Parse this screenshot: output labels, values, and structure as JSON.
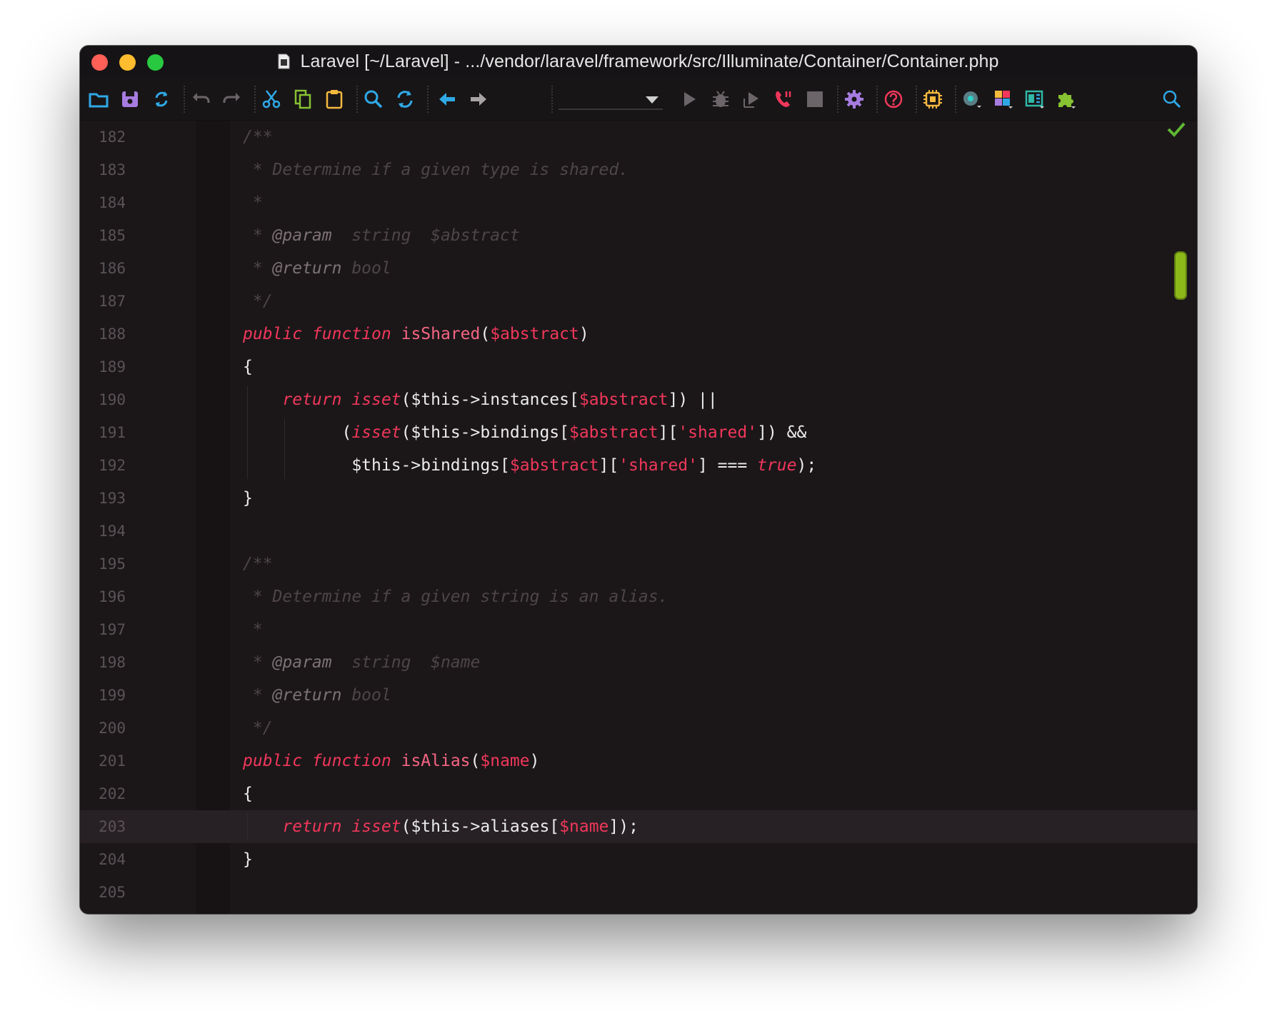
{
  "window": {
    "title": "Laravel [~/Laravel] - .../vendor/laravel/framework/src/Illuminate/Container/Container.php"
  },
  "toolbar": {
    "icons": [
      "folder-open-icon",
      "save-icon",
      "sync-icon",
      "undo-icon",
      "redo-icon",
      "cut-icon",
      "copy-icon",
      "paste-icon",
      "search-icon",
      "replace-icon",
      "back-icon",
      "forward-icon",
      "run-config-select",
      "run-icon",
      "debug-icon",
      "run-to-cursor-icon",
      "phone-listen-icon",
      "stop-icon",
      "settings-icon",
      "help-icon",
      "cpu-icon",
      "vcs-icon",
      "layout-icon",
      "panel-icon",
      "plugins-icon",
      "search-everywhere-icon"
    ],
    "run_config_value": "",
    "colors": {
      "blue": "#2fa9e6",
      "purple": "#a77ce0",
      "teal": "#2fa9e6",
      "green": "#86c232",
      "red": "#f1375a",
      "yellow": "#f5b93e"
    }
  },
  "editor": {
    "current_line": 203,
    "lines": [
      {
        "n": "182",
        "tokens": [
          [
            "cm",
            "/**"
          ]
        ]
      },
      {
        "n": "183",
        "tokens": [
          [
            "cm",
            " * Determine if a given type is shared."
          ]
        ]
      },
      {
        "n": "184",
        "tokens": [
          [
            "cm",
            " *"
          ]
        ]
      },
      {
        "n": "185",
        "tokens": [
          [
            "cm",
            " * "
          ],
          [
            "tag",
            "@param"
          ],
          [
            "cm",
            "  string  $abstract"
          ]
        ]
      },
      {
        "n": "186",
        "tokens": [
          [
            "cm",
            " * "
          ],
          [
            "tag",
            "@return"
          ],
          [
            "cm",
            " bool"
          ]
        ]
      },
      {
        "n": "187",
        "tokens": [
          [
            "cm",
            " */"
          ]
        ]
      },
      {
        "n": "188",
        "tokens": [
          [
            "kw",
            "public"
          ],
          [
            "plain",
            " "
          ],
          [
            "kw",
            "function"
          ],
          [
            "plain",
            " "
          ],
          [
            "fn",
            "isShared"
          ],
          [
            "plain",
            "("
          ],
          [
            "var",
            "$abstract"
          ],
          [
            "plain",
            ")"
          ]
        ]
      },
      {
        "n": "189",
        "tokens": [
          [
            "plain",
            "{"
          ]
        ]
      },
      {
        "n": "190",
        "tokens": [
          [
            "plain",
            "    "
          ],
          [
            "kw",
            "return"
          ],
          [
            "plain",
            " "
          ],
          [
            "kw",
            "isset"
          ],
          [
            "plain",
            "($this->instances["
          ],
          [
            "var",
            "$abstract"
          ],
          [
            "plain",
            "]) ||"
          ]
        ]
      },
      {
        "n": "191",
        "tokens": [
          [
            "plain",
            "          ("
          ],
          [
            "kw",
            "isset"
          ],
          [
            "plain",
            "($this->bindings["
          ],
          [
            "var",
            "$abstract"
          ],
          [
            "plain",
            "]["
          ],
          [
            "str",
            "'shared'"
          ],
          [
            "plain",
            "]) &&"
          ]
        ]
      },
      {
        "n": "192",
        "tokens": [
          [
            "plain",
            "           $this->bindings["
          ],
          [
            "var",
            "$abstract"
          ],
          [
            "plain",
            "]["
          ],
          [
            "str",
            "'shared'"
          ],
          [
            "plain",
            "] === "
          ],
          [
            "kw",
            "true"
          ],
          [
            "plain",
            ");"
          ]
        ]
      },
      {
        "n": "193",
        "tokens": [
          [
            "plain",
            "}"
          ]
        ]
      },
      {
        "n": "194",
        "tokens": []
      },
      {
        "n": "195",
        "tokens": [
          [
            "cm",
            "/**"
          ]
        ]
      },
      {
        "n": "196",
        "tokens": [
          [
            "cm",
            " * Determine if a given string is an alias."
          ]
        ]
      },
      {
        "n": "197",
        "tokens": [
          [
            "cm",
            " *"
          ]
        ]
      },
      {
        "n": "198",
        "tokens": [
          [
            "cm",
            " * "
          ],
          [
            "tag",
            "@param"
          ],
          [
            "cm",
            "  string  $name"
          ]
        ]
      },
      {
        "n": "199",
        "tokens": [
          [
            "cm",
            " * "
          ],
          [
            "tag",
            "@return"
          ],
          [
            "cm",
            " bool"
          ]
        ]
      },
      {
        "n": "200",
        "tokens": [
          [
            "cm",
            " */"
          ]
        ]
      },
      {
        "n": "201",
        "tokens": [
          [
            "kw",
            "public"
          ],
          [
            "plain",
            " "
          ],
          [
            "kw",
            "function"
          ],
          [
            "plain",
            " "
          ],
          [
            "fn",
            "isAlias"
          ],
          [
            "plain",
            "("
          ],
          [
            "var",
            "$name"
          ],
          [
            "plain",
            ")"
          ]
        ]
      },
      {
        "n": "202",
        "tokens": [
          [
            "plain",
            "{"
          ]
        ]
      },
      {
        "n": "203",
        "tokens": [
          [
            "plain",
            "    "
          ],
          [
            "kw",
            "return"
          ],
          [
            "plain",
            " "
          ],
          [
            "kw",
            "isset"
          ],
          [
            "plain",
            "($this->aliases["
          ],
          [
            "var",
            "$name"
          ],
          [
            "plain",
            "]);"
          ]
        ]
      },
      {
        "n": "204",
        "tokens": [
          [
            "plain",
            "}"
          ]
        ]
      },
      {
        "n": "205",
        "tokens": []
      }
    ]
  },
  "status": {
    "inspection_icon": "checkmark-icon",
    "scroll_marker_color": "#8db81a"
  }
}
